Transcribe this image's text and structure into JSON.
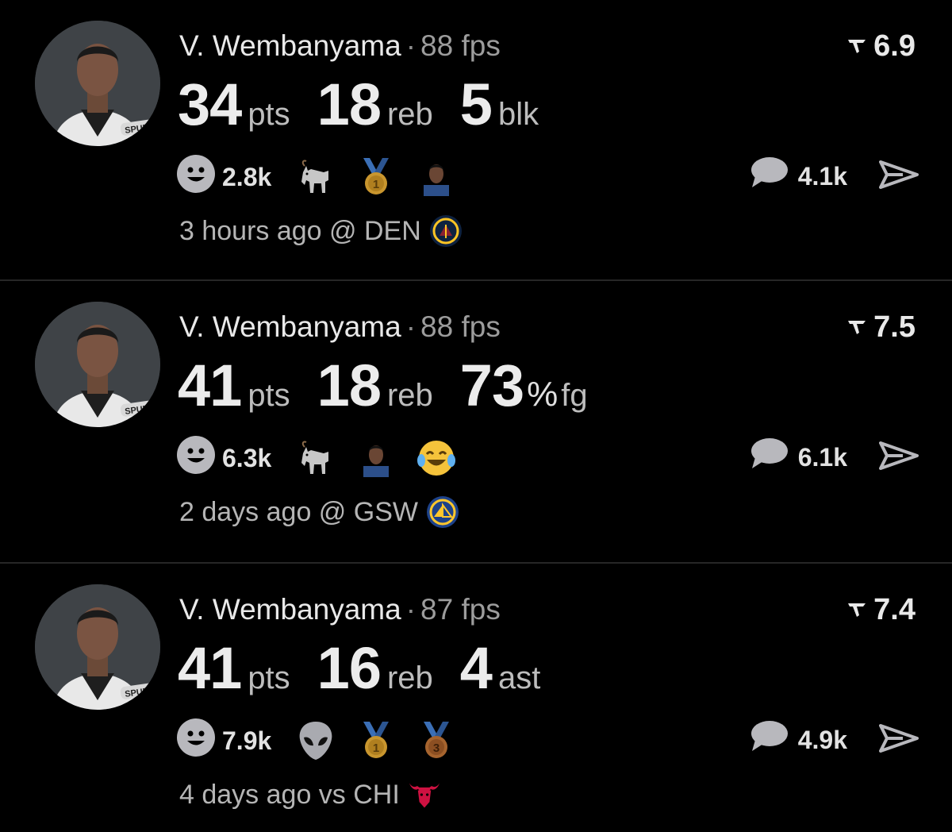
{
  "feed": [
    {
      "player": "V. Wembanyama",
      "separator": "·",
      "fps": "88 fps",
      "rating": "6.9",
      "stats": [
        {
          "value": "34",
          "pct": "",
          "unit": "pts"
        },
        {
          "value": "18",
          "pct": "",
          "unit": "reb"
        },
        {
          "value": "5",
          "pct": "",
          "unit": "blk"
        }
      ],
      "reaction_count": "2.8k",
      "reaction_icons": [
        "goat-icon",
        "gold-medal-icon",
        "player-face-icon"
      ],
      "medal_labels": [
        "1"
      ],
      "comment_count": "4.1k",
      "footer": "3 hours ago @ DEN",
      "opponent_logo": "nuggets-logo-icon"
    },
    {
      "player": "V. Wembanyama",
      "separator": "·",
      "fps": "88 fps",
      "rating": "7.5",
      "stats": [
        {
          "value": "41",
          "pct": "",
          "unit": "pts"
        },
        {
          "value": "18",
          "pct": "",
          "unit": "reb"
        },
        {
          "value": "73",
          "pct": "%",
          "unit": "fg"
        }
      ],
      "reaction_count": "6.3k",
      "reaction_icons": [
        "goat-icon",
        "player-face-icon",
        "laughing-crying-emoji-icon"
      ],
      "medal_labels": [],
      "comment_count": "6.1k",
      "footer": "2 days ago @ GSW",
      "opponent_logo": "warriors-logo-icon"
    },
    {
      "player": "V. Wembanyama",
      "separator": "·",
      "fps": "87 fps",
      "rating": "7.4",
      "stats": [
        {
          "value": "41",
          "pct": "",
          "unit": "pts"
        },
        {
          "value": "16",
          "pct": "",
          "unit": "reb"
        },
        {
          "value": "4",
          "pct": "",
          "unit": "ast"
        }
      ],
      "reaction_count": "7.9k",
      "reaction_icons": [
        "alien-icon",
        "gold-medal-icon",
        "bronze-medal-icon"
      ],
      "medal_labels": [
        "1",
        "3"
      ],
      "comment_count": "4.9k",
      "footer": "4 days ago vs CHI",
      "opponent_logo": "bulls-logo-icon"
    }
  ],
  "colors": {
    "background": "#000000",
    "divider": "#262626",
    "avatar_bg": "#3f4347",
    "gold": "#c9962e",
    "bronze": "#a6642e",
    "ribbon_blue": "#3b6fb6"
  }
}
